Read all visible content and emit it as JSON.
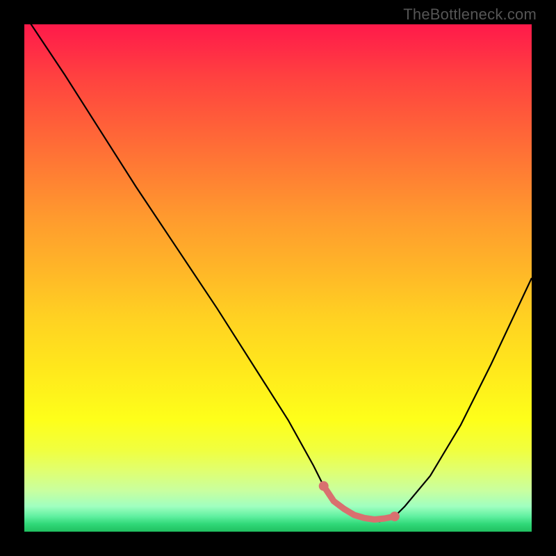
{
  "watermark": "TheBottleneck.com",
  "chart_data": {
    "type": "line",
    "title": "",
    "xlabel": "",
    "ylabel": "",
    "xlim": [
      0,
      100
    ],
    "ylim": [
      0,
      100
    ],
    "series": [
      {
        "name": "bottleneck-curve",
        "x": [
          0,
          8,
          15,
          22,
          30,
          38,
          45,
          52,
          57,
          59,
          61,
          65,
          70,
          73,
          75,
          80,
          86,
          92,
          100
        ],
        "values": [
          102,
          90,
          79,
          68,
          56,
          44,
          33,
          22,
          13,
          9,
          6,
          3,
          2,
          3,
          5,
          11,
          21,
          33,
          50
        ]
      }
    ],
    "markers": [
      {
        "name": "optimal-start",
        "x": 59,
        "y": 9,
        "size": 6
      },
      {
        "name": "optimal-end",
        "x": 73,
        "y": 3,
        "size": 6
      }
    ],
    "optimal_band": {
      "points_x": [
        59,
        61,
        63,
        65,
        67,
        69,
        71,
        73
      ],
      "points_y": [
        9,
        6,
        4.5,
        3.3,
        2.7,
        2.4,
        2.6,
        3
      ]
    },
    "gradient_stops": [
      {
        "pos": 0,
        "color": "#ff1a4a"
      },
      {
        "pos": 50,
        "color": "#ffd222"
      },
      {
        "pos": 95,
        "color": "#a0ffc0"
      },
      {
        "pos": 100,
        "color": "#20c060"
      }
    ],
    "marker_color": "#d9706f",
    "line_color": "#000000"
  }
}
